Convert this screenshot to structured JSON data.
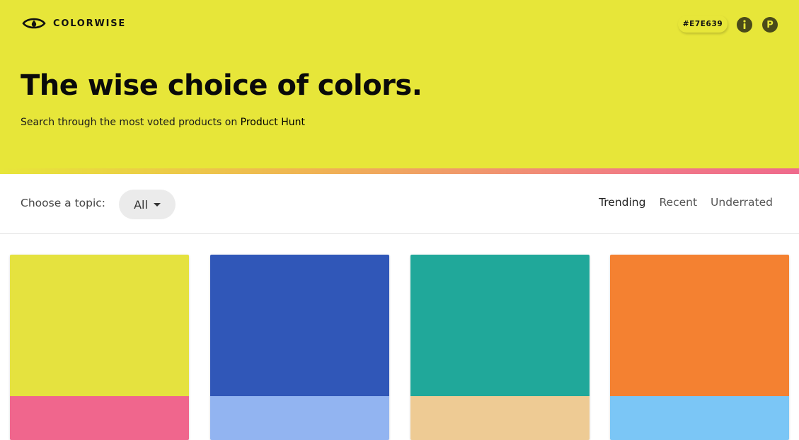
{
  "header": {
    "logo_text": "COLORWISE",
    "logo_icon": "eye-icon",
    "current_hex": "#E7E639",
    "info_icon": "info-icon",
    "product_hunt_label": "P",
    "product_hunt_icon": "product-hunt-icon"
  },
  "hero": {
    "headline": "The wise choice of colors.",
    "subline_prefix": "Search through the most voted products on ",
    "subline_link": "Product Hunt"
  },
  "toolbar": {
    "topic_label": "Choose a topic:",
    "topic_selected": "All",
    "sort_tabs": [
      "Trending",
      "Recent",
      "Underrated"
    ],
    "active_sort": "Trending"
  },
  "theme": {
    "background": "#E7E639",
    "stripe_colors": [
      "#E7E639",
      "#EF6A8C"
    ]
  },
  "cards": [
    {
      "primary": "#E5E23F",
      "secondary": "#F0668D"
    },
    {
      "primary": "#3057B8",
      "secondary": "#92B4F1"
    },
    {
      "primary": "#20A89A",
      "secondary": "#EECB94"
    },
    {
      "primary": "#F48131",
      "secondary": "#7BC6F6"
    }
  ]
}
